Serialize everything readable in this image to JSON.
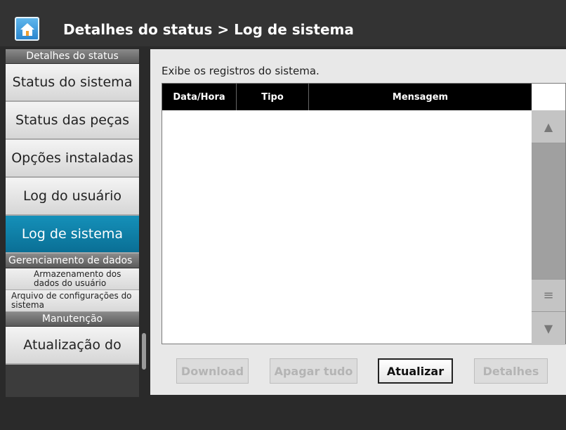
{
  "header": {
    "title": "Detalhes do status > Log de sistema"
  },
  "sidebar": {
    "section_status": "Detalhes do status",
    "items": [
      {
        "label": "Status do sistema"
      },
      {
        "label": "Status das peças"
      },
      {
        "label": "Opções instaladas"
      },
      {
        "label": "Log do usuário"
      },
      {
        "label": "Log de sistema",
        "active": true
      }
    ],
    "section_data": "Gerenciamento de dados",
    "data_items": [
      {
        "label": "Armazenamento dos dados do usuário"
      },
      {
        "label": "Arquivo de configurações do sistema"
      }
    ],
    "section_maintenance": "Manutenção",
    "maintenance_items": [
      {
        "label": "Atualização do"
      }
    ]
  },
  "main": {
    "description": "Exibe os registros do sistema.",
    "table": {
      "columns": [
        "Data/Hora",
        "Tipo",
        "Mensagem"
      ],
      "rows": []
    },
    "buttons": {
      "download": "Download",
      "clear_all": "Apagar tudo",
      "refresh": "Atualizar",
      "details": "Detalhes"
    }
  },
  "colors": {
    "active_nav": "#1590b9",
    "header_bg": "#333333",
    "table_header_bg": "#000000"
  }
}
